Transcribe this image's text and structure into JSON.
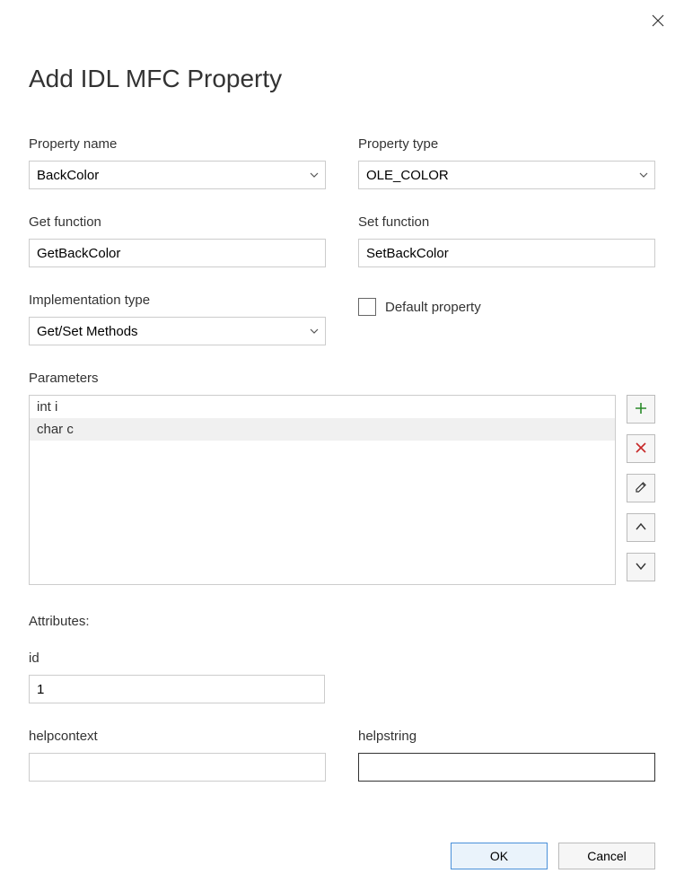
{
  "dialog": {
    "title": "Add IDL MFC Property",
    "close_tooltip": "Close"
  },
  "fields": {
    "property_name": {
      "label": "Property name",
      "value": "BackColor"
    },
    "property_type": {
      "label": "Property type",
      "value": "OLE_COLOR"
    },
    "get_function": {
      "label": "Get function",
      "value": "GetBackColor"
    },
    "set_function": {
      "label": "Set function",
      "value": "SetBackColor"
    },
    "implementation_type": {
      "label": "Implementation type",
      "value": "Get/Set Methods"
    },
    "default_property": {
      "label": "Default property",
      "checked": false
    }
  },
  "parameters": {
    "label": "Parameters",
    "items": [
      "int i",
      "char c"
    ],
    "selected_index": 1
  },
  "attributes": {
    "heading": "Attributes:",
    "id": {
      "label": "id",
      "value": "1"
    },
    "helpcontext": {
      "label": "helpcontext",
      "value": ""
    },
    "helpstring": {
      "label": "helpstring",
      "value": ""
    }
  },
  "buttons": {
    "ok": "OK",
    "cancel": "Cancel"
  }
}
